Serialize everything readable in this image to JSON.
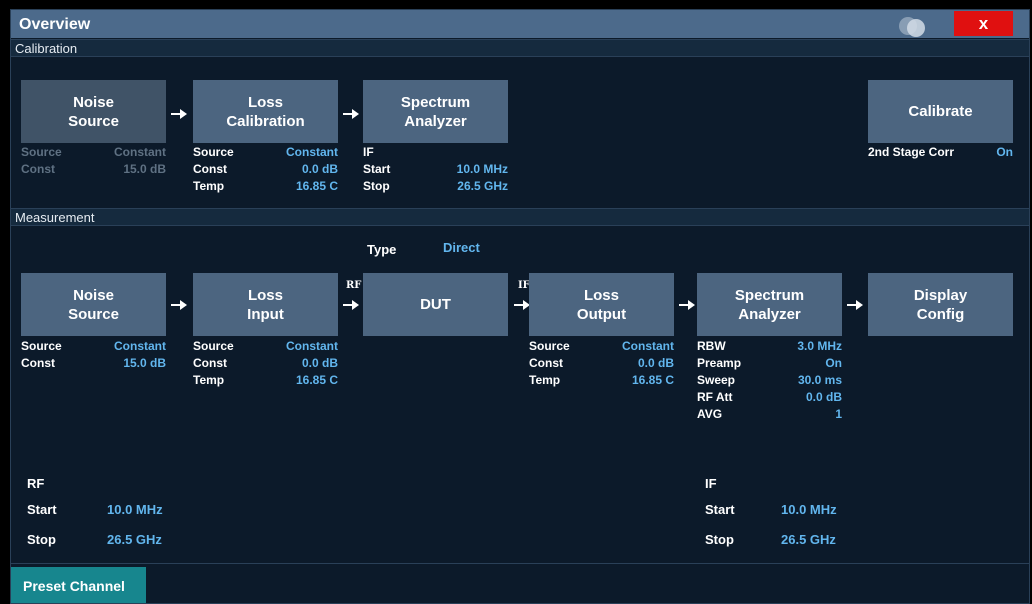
{
  "window": {
    "title": "Overview",
    "close_label": "x"
  },
  "calibration": {
    "section_label": "Calibration",
    "noise_source": {
      "label_line1": "Noise",
      "label_line2": "Source",
      "params": [
        {
          "label": "Source",
          "value": "Constant"
        },
        {
          "label": "Const",
          "value": "15.0 dB"
        }
      ]
    },
    "loss": {
      "label_line1": "Loss",
      "label_line2": "Calibration",
      "params": [
        {
          "label": "Source",
          "value": "Constant"
        },
        {
          "label": "Const",
          "value": "0.0 dB"
        },
        {
          "label": "Temp",
          "value": "16.85 C"
        }
      ]
    },
    "analyzer": {
      "label_line1": "Spectrum",
      "label_line2": "Analyzer",
      "if_label": "IF",
      "params": [
        {
          "label": "Start",
          "value": "10.0 MHz"
        },
        {
          "label": "Stop",
          "value": "26.5 GHz"
        }
      ]
    },
    "calibrate": {
      "label": "Calibrate",
      "second_stage_label": "2nd Stage Corr",
      "second_stage_value": "On"
    }
  },
  "measurement": {
    "section_label": "Measurement",
    "type_label": "Type",
    "type_value": "Direct",
    "noise_source": {
      "label_line1": "Noise",
      "label_line2": "Source",
      "params": [
        {
          "label": "Source",
          "value": "Constant"
        },
        {
          "label": "Const",
          "value": "15.0 dB"
        }
      ]
    },
    "loss_input": {
      "label_line1": "Loss",
      "label_line2": "Input",
      "params": [
        {
          "label": "Source",
          "value": "Constant"
        },
        {
          "label": "Const",
          "value": "0.0 dB"
        },
        {
          "label": "Temp",
          "value": "16.85 C"
        }
      ]
    },
    "rf_tag": "RF",
    "dut": {
      "label": "DUT"
    },
    "if_tag": "IF",
    "loss_output": {
      "label_line1": "Loss",
      "label_line2": "Output",
      "params": [
        {
          "label": "Source",
          "value": "Constant"
        },
        {
          "label": "Const",
          "value": "0.0 dB"
        },
        {
          "label": "Temp",
          "value": "16.85 C"
        }
      ]
    },
    "analyzer": {
      "label_line1": "Spectrum",
      "label_line2": "Analyzer",
      "params": [
        {
          "label": "RBW",
          "value": "3.0 MHz"
        },
        {
          "label": "Preamp",
          "value": "On"
        },
        {
          "label": "Sweep",
          "value": "30.0 ms"
        },
        {
          "label": "RF Att",
          "value": "0.0 dB"
        },
        {
          "label": "AVG",
          "value": "1"
        }
      ]
    },
    "display_config": {
      "label_line1": "Display",
      "label_line2": "Config"
    },
    "rf_range": {
      "header": "RF",
      "start_label": "Start",
      "start_value": "10.0 MHz",
      "stop_label": "Stop",
      "stop_value": "26.5 GHz"
    },
    "if_range": {
      "header": "IF",
      "start_label": "Start",
      "start_value": "10.0 MHz",
      "stop_label": "Stop",
      "stop_value": "26.5 GHz"
    }
  },
  "footer": {
    "preset_label": "Preset Channel"
  }
}
